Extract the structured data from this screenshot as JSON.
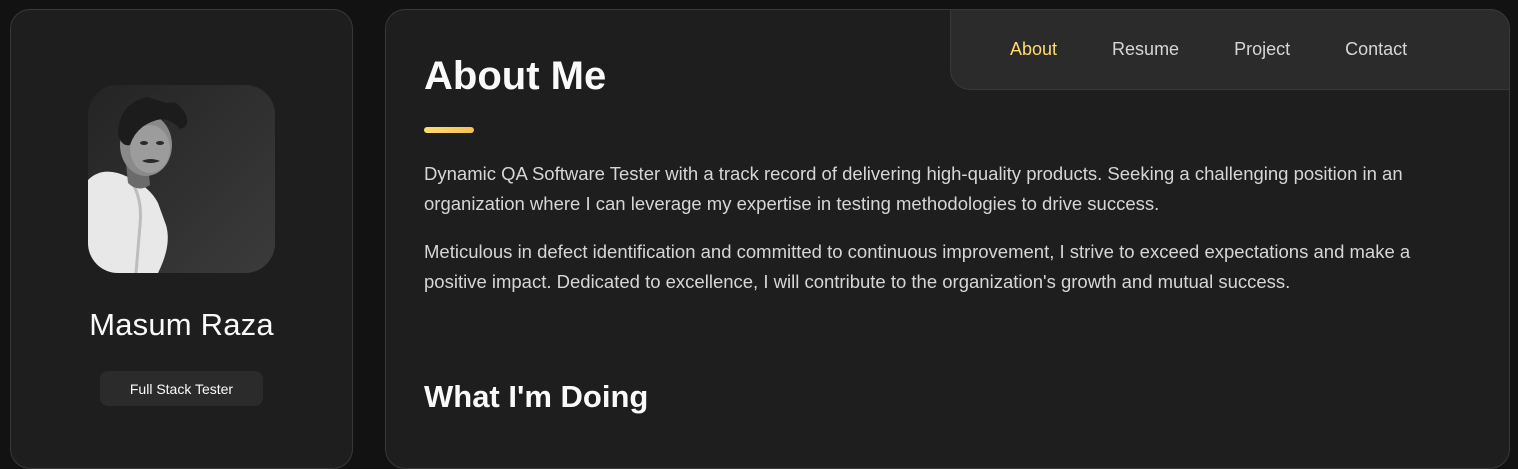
{
  "profile": {
    "name": "Masum Raza",
    "title": "Full Stack Tester",
    "avatar_alt": "Masum Raza"
  },
  "nav": {
    "items": [
      {
        "label": "About",
        "active": true
      },
      {
        "label": "Resume",
        "active": false
      },
      {
        "label": "Project",
        "active": false
      },
      {
        "label": "Contact",
        "active": false
      }
    ]
  },
  "about": {
    "heading": "About Me",
    "paragraphs": [
      "Dynamic QA Software Tester with a track record of delivering high-quality products. Seeking a challenging position in an organization where I can leverage my expertise in testing methodologies to drive success.",
      "Meticulous in defect identification and committed to continuous improvement, I strive to exceed expectations and make a positive impact. Dedicated to excellence, I will contribute to the organization's growth and mutual success."
    ],
    "section_heading": "What I'm Doing"
  },
  "colors": {
    "accent": "#ffdb70",
    "background": "#121212",
    "card": "#1e1e1f",
    "nav_bg": "#2b2b2c",
    "text_muted": "#d6d6d6"
  }
}
